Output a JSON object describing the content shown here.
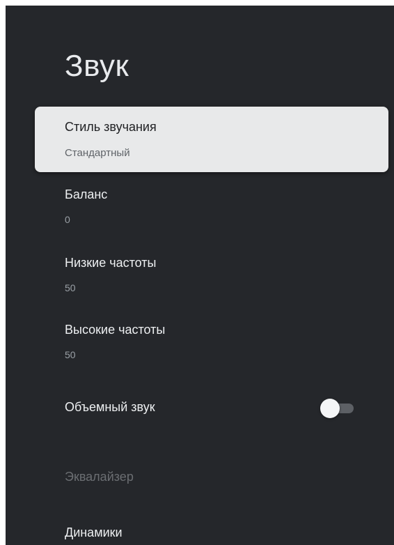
{
  "page": {
    "title": "Звук"
  },
  "settings": {
    "sound_style": {
      "label": "Стиль звучания",
      "value": "Стандартный"
    },
    "balance": {
      "label": "Баланс",
      "value": "0"
    },
    "bass": {
      "label": "Низкие частоты",
      "value": "50"
    },
    "treble": {
      "label": "Высокие частоты",
      "value": "50"
    },
    "surround": {
      "label": "Объемный звук",
      "enabled": false
    },
    "equalizer": {
      "label": "Эквалайзер"
    },
    "speakers": {
      "label": "Динамики"
    }
  },
  "colors": {
    "background": "#25272b",
    "selected_item": "#e8e9ea",
    "primary_text": "#eef0f2",
    "secondary_text": "#9aa0a6",
    "disabled_text": "#6b6e72"
  }
}
